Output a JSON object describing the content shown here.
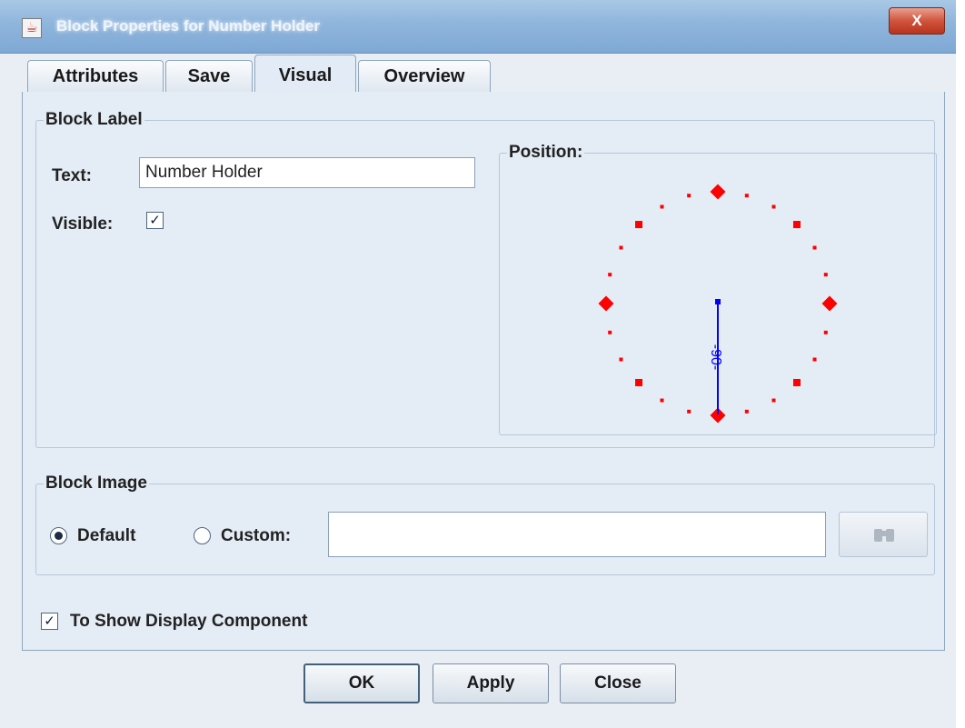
{
  "window": {
    "title": "Block Properties for Number Holder",
    "close_label": "X",
    "app_icon": "java-coffee-icon"
  },
  "tabs": [
    {
      "label": "Attributes",
      "active": false
    },
    {
      "label": "Save",
      "active": false
    },
    {
      "label": "Visual",
      "active": true
    },
    {
      "label": "Overview",
      "active": false
    }
  ],
  "block_label": {
    "group_title": "Block Label",
    "text_label": "Text:",
    "text_value": "Number Holder",
    "visible_label": "Visible:",
    "visible_checked": true,
    "position_title": "Position:",
    "position_angle_label": "-90-",
    "marker_color": "#ff0000",
    "indicator_color": "#0000ff"
  },
  "block_image": {
    "group_title": "Block Image",
    "default_label": "Default",
    "custom_label": "Custom:",
    "selected": "Default",
    "custom_path": "",
    "browse_icon": "binoculars-icon"
  },
  "show_display": {
    "label": "To Show Display Component",
    "checked": true
  },
  "buttons": {
    "ok": "OK",
    "apply": "Apply",
    "close": "Close"
  },
  "colors": {
    "title_bar": "#8fb5dc",
    "close_button": "#d1543c",
    "panel_bg": "#e4ecf5"
  }
}
